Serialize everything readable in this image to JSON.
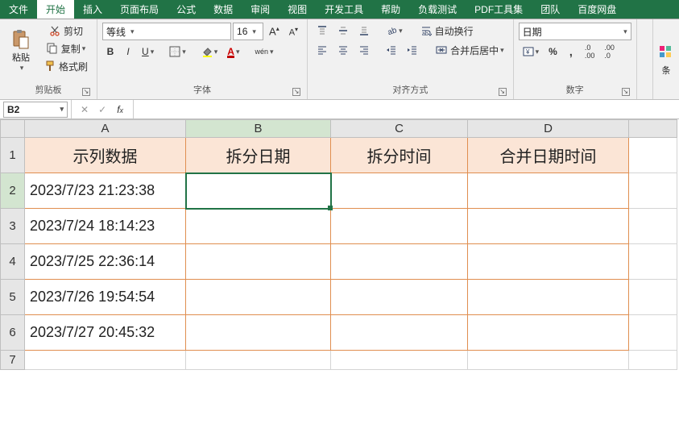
{
  "menu": {
    "tabs": [
      "文件",
      "开始",
      "插入",
      "页面布局",
      "公式",
      "数据",
      "审阅",
      "视图",
      "开发工具",
      "帮助",
      "负载测试",
      "PDF工具集",
      "团队",
      "百度网盘"
    ],
    "active_index": 1
  },
  "ribbon": {
    "clipboard": {
      "paste": "粘贴",
      "cut": "剪切",
      "copy": "复制",
      "format_painter": "格式刷",
      "group_label": "剪贴板"
    },
    "font": {
      "name": "等线",
      "size": "16",
      "group_label": "字体",
      "ruby": "wén"
    },
    "alignment": {
      "wrap": "自动换行",
      "merge": "合并后居中",
      "group_label": "对齐方式"
    },
    "number": {
      "format": "日期",
      "group_label": "数字"
    },
    "styles": {
      "cond_format": "条"
    }
  },
  "fx": {
    "namebox": "B2",
    "formula": ""
  },
  "grid": {
    "columns": [
      "A",
      "B",
      "C",
      "D",
      ""
    ],
    "row_count": 7,
    "headers": [
      "示列数据",
      "拆分日期",
      "拆分时间",
      "合并日期时间"
    ],
    "rows": [
      [
        "2023/7/23 21:23:38",
        "",
        "",
        ""
      ],
      [
        "2023/7/24 18:14:23",
        "",
        "",
        ""
      ],
      [
        "2023/7/25 22:36:14",
        "",
        "",
        ""
      ],
      [
        "2023/7/26 19:54:54",
        "",
        "",
        ""
      ],
      [
        "2023/7/27 20:45:32",
        "",
        "",
        ""
      ]
    ],
    "selected": {
      "col": "B",
      "row": 2
    }
  }
}
